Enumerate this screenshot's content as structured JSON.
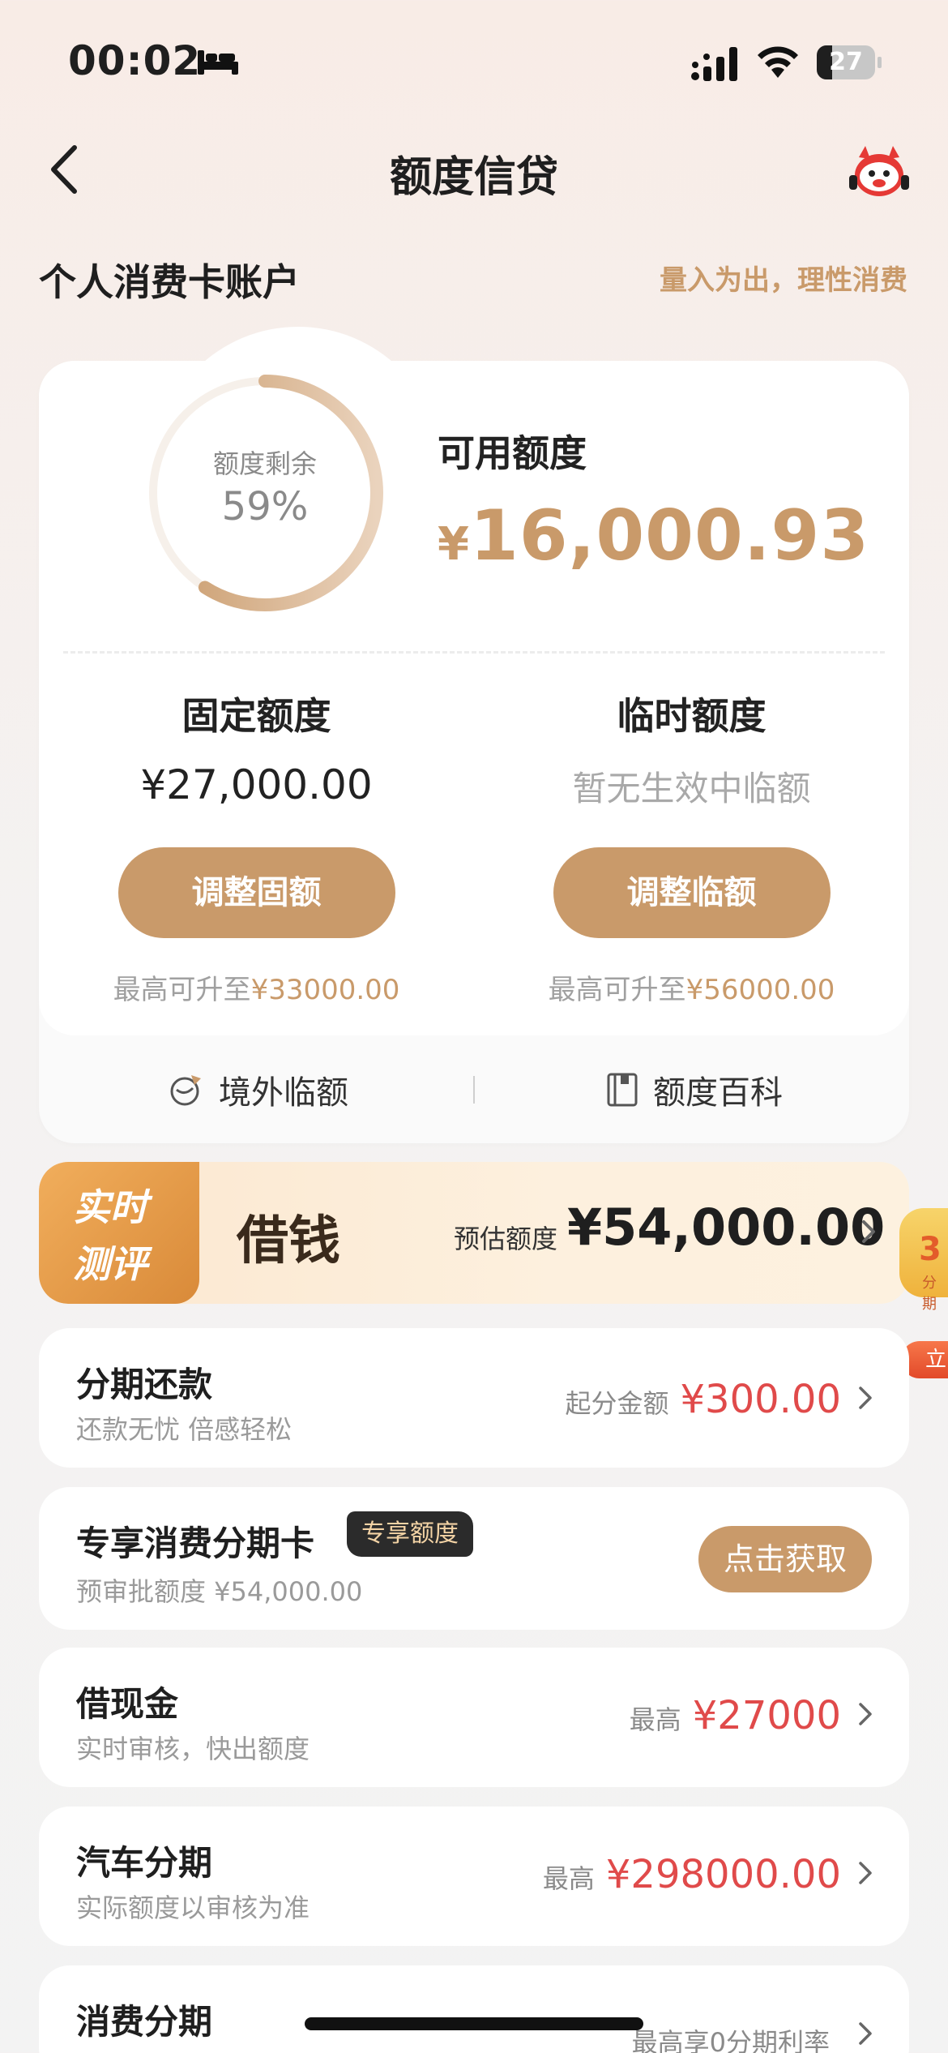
{
  "status_bar": {
    "time": "00:02",
    "battery_level": "27",
    "battery_fraction": 0.27,
    "icons": [
      "bed-icon",
      "signal-icon",
      "wifi-icon",
      "battery-icon"
    ]
  },
  "nav": {
    "title": "额度信贷",
    "icons": [
      "back-icon",
      "mascot-icon"
    ]
  },
  "section": {
    "title": "个人消费卡账户",
    "slogan": "量入为出，理性消费"
  },
  "account_card": {
    "gauge_label": "额度剩余",
    "gauge_value": "59%",
    "gauge_fraction": 0.59,
    "available_label": "可用额度",
    "available_currency": "¥",
    "available_amount": "16,000.93",
    "fixed": {
      "title": "固定额度",
      "amount": "¥27,000.00",
      "button": "调整固额",
      "hint_prefix": "最高可升至",
      "hint_value": "¥33000.00"
    },
    "temporary": {
      "title": "临时额度",
      "status": "暂无生效中临额",
      "button": "调整临额",
      "hint_prefix": "最高可升至",
      "hint_value": "¥56000.00"
    },
    "footer": {
      "overseas_label": "境外临额",
      "wiki_label": "额度百科"
    }
  },
  "banner": {
    "tag_line1": "实时",
    "tag_line2": "测评",
    "title": "借钱",
    "estimate_label": "预估额度",
    "estimate_amount": "¥54,000.00"
  },
  "side_float": {
    "number": "3",
    "sub": "分期",
    "button": "立"
  },
  "items": [
    {
      "title": "分期还款",
      "subtitle": "还款无忧 倍感轻松",
      "right_label": "起分金额",
      "right_value": "¥300.00"
    },
    {
      "title": "专享消费分期卡",
      "tag": "专享额度",
      "subtitle": "预审批额度 ¥54,000.00",
      "button": "点击获取"
    },
    {
      "title": "借现金",
      "subtitle": "实时审核，快出额度",
      "right_label": "最高",
      "right_value": "¥27000"
    },
    {
      "title": "汽车分期",
      "subtitle": "实际额度以审核为准",
      "right_label": "最高",
      "right_value": "¥298000.00"
    },
    {
      "title": "消费分期",
      "right_label": "最高享0分期利率"
    }
  ],
  "colors": {
    "accent_gold": "#c99a6a",
    "value_red": "#e04a4a",
    "banner_orange": "#d98a39"
  }
}
